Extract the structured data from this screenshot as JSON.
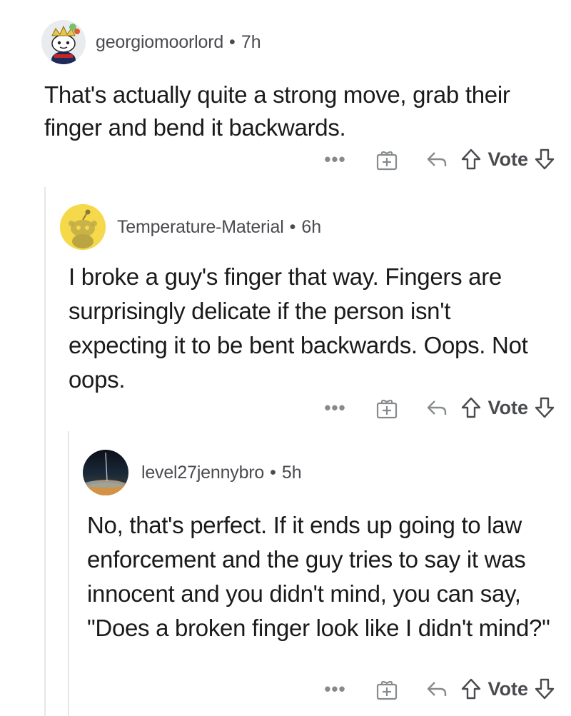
{
  "comments": [
    {
      "username": "georgiomoorlord",
      "separator": "•",
      "time": "7h",
      "avatar_icon": "snoo-avatar-crown",
      "body": "That's actually quite a strong move, grab their finger and bend it backwards.",
      "actions": {
        "more": "•••",
        "vote_label": "Vote"
      }
    },
    {
      "username": "Temperature-Material",
      "separator": "•",
      "time": "6h",
      "avatar_icon": "snoo-avatar-yellow",
      "body": "I broke a guy's finger that way. Fingers are surprisingly delicate if the person isn't expecting it to be bent backwards. Oops. Not oops.",
      "actions": {
        "more": "•••",
        "vote_label": "Vote"
      }
    },
    {
      "username": "level27jennybro",
      "separator": "•",
      "time": "5h",
      "avatar_icon": "photo-avatar-planet",
      "body": "No, that's perfect.  If it ends up going to law enforcement and the guy tries to say it was innocent and you didn't mind, you can say, \"Does a broken finger look like I didn't mind?\"",
      "actions": {
        "more": "•••",
        "vote_label": "Vote"
      }
    }
  ],
  "colors": {
    "meta_text": "#4a4b4f",
    "icon_gray": "#878a8c",
    "thread_line": "#e6e7ea",
    "avatar_yellow": "#f5d94a"
  }
}
